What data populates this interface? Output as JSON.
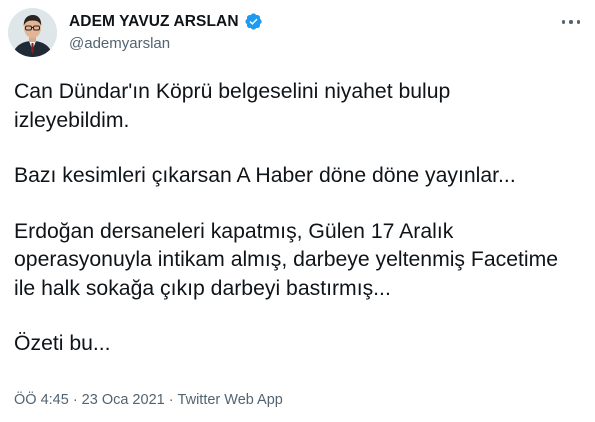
{
  "tweet": {
    "author": {
      "display_name": "ADEM YAVUZ ARSLAN",
      "handle": "@ademyarslan",
      "verified": true,
      "avatar_icon": "profile-photo"
    },
    "paragraphs": [
      "Can Dündar'ın Köprü belgeselini niyahet bulup\nizleyebildim.",
      "Bazı kesimleri çıkarsan A Haber döne döne yayınlar...",
      "Erdoğan dersaneleri kapatmış, Gülen 17 Aralık\noperasyonuyla intikam almış, darbeye yeltenmiş Facetime\nile halk sokağa çıkıp darbeyi bastırmış...",
      "Özeti bu..."
    ],
    "meta": {
      "time": "ÖÖ 4:45",
      "separator": "·",
      "date": "23 Oca 2021",
      "source": "Twitter Web App"
    },
    "colors": {
      "text": "#0f1419",
      "secondary": "#536471",
      "verified_badge": "#1d9bf0"
    }
  }
}
